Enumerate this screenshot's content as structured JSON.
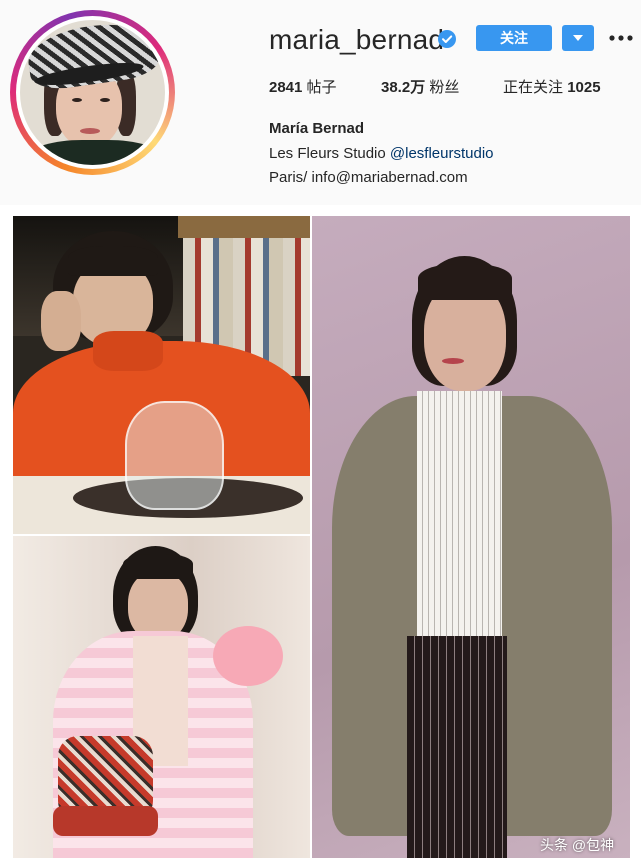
{
  "profile": {
    "username": "maria_bernad",
    "verified_icon": "verified-badge-icon",
    "follow_label": "关注",
    "dropdown_icon": "triangle-down-icon",
    "more_icon": "more-dots-icon",
    "accent_color": "#3897f0",
    "stats": {
      "posts_count": "2841",
      "posts_label": "帖子",
      "followers_count": "38.2万",
      "followers_label": "粉丝",
      "following_label": "正在关注",
      "following_count": "1025"
    },
    "full_name": "María Bernad",
    "bio_line1_text": "Les Fleurs Studio ",
    "bio_line1_mention": "@lesfleurstudio",
    "bio_line2": "Paris/ info@mariabernad.com"
  },
  "photos": [
    {
      "name": "photo-orange-sweater"
    },
    {
      "name": "photo-pink-jacket-bag"
    },
    {
      "name": "photo-blazer-pinstripe"
    }
  ],
  "watermark": "头条 @包神"
}
